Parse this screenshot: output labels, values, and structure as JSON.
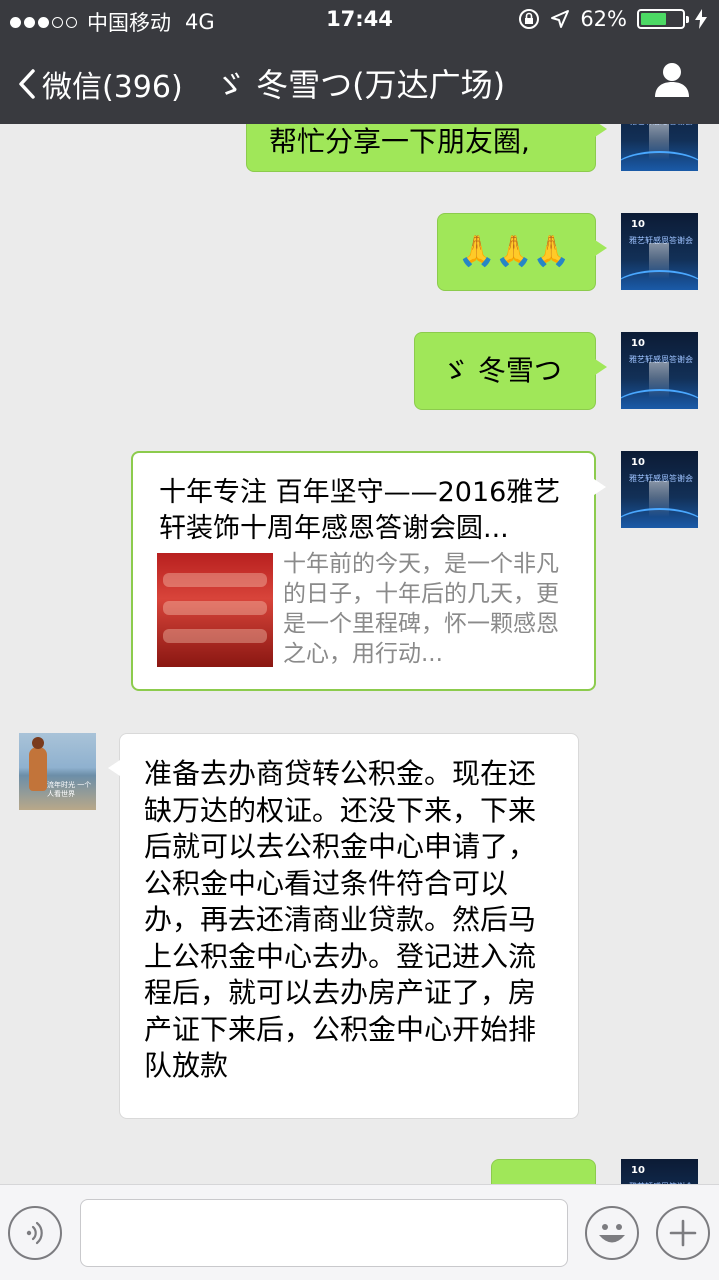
{
  "status_bar": {
    "carrier": "中国移动",
    "network": "4G",
    "time": "17:44",
    "battery_percent": "62%",
    "battery_level": 0.62
  },
  "nav": {
    "back_label": "微信(396)",
    "title": "ゞ 冬雪つ(万达广场)"
  },
  "messages": [
    {
      "side": "right",
      "type": "text",
      "text": "帮忙分享一下朋友圈,"
    },
    {
      "side": "right",
      "type": "emoji",
      "text": "🙏🙏🙏"
    },
    {
      "side": "right",
      "type": "text",
      "text": "ゞ 冬雪つ"
    },
    {
      "side": "right",
      "type": "link",
      "title": "十年专注 百年坚守——2016雅艺轩装饰十周年感恩答谢会圆...",
      "description": "十年前的今天，是一个非凡的日子，十年后的几天，更是一个里程碑，怀一颗感恩之心，用行动..."
    },
    {
      "side": "left",
      "type": "text",
      "text": "准备去办商贷转公积金。现在还缺万达的权证。还没下来，下来后就可以去公积金中心申请了，公积金中心看过条件符合可以办，再去还清商业贷款。然后马上公积金中心去办。登记进入流程后，就可以去办房产证了，房产证下来后，公积金中心开始排队放款"
    },
    {
      "side": "right",
      "type": "text",
      "text": ""
    }
  ],
  "self_avatar": {
    "title": "10",
    "subtitle": "雅艺轩感恩答谢会"
  },
  "friend_avatar": {
    "caption": "流年时光 一个人看世界"
  },
  "icons": {
    "back": "chevron-left-icon",
    "profile": "person-icon",
    "voice": "voice-icon",
    "emoji": "smiley-icon",
    "more": "plus-icon"
  },
  "colors": {
    "nav_bg": "#393a3f",
    "chat_bg": "#ebebeb",
    "green_bubble": "#a0e759",
    "battery": "#4cd964"
  }
}
